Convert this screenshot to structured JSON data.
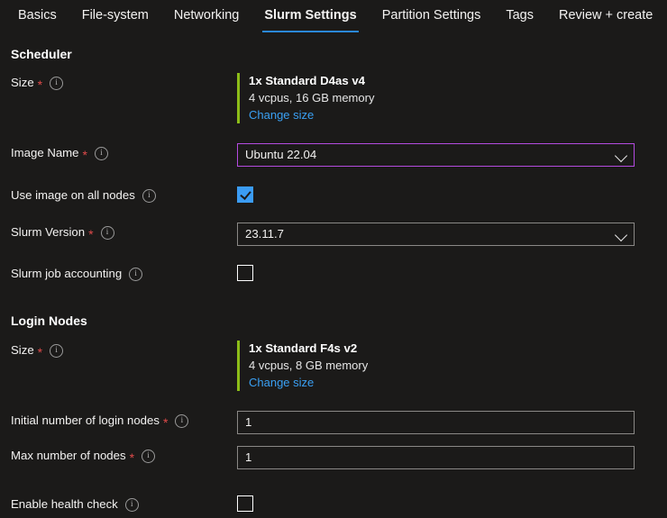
{
  "tabs": [
    {
      "label": "Basics",
      "active": false
    },
    {
      "label": "File-system",
      "active": false
    },
    {
      "label": "Networking",
      "active": false
    },
    {
      "label": "Slurm Settings",
      "active": true
    },
    {
      "label": "Partition Settings",
      "active": false
    },
    {
      "label": "Tags",
      "active": false
    },
    {
      "label": "Review + create",
      "active": false
    }
  ],
  "colors": {
    "page_background": "#1b1a19",
    "accent_tab_underline": "#2b88d8",
    "size_accent_bar": "#8cbd18",
    "link": "#3aa0f3",
    "focus_border": "#b44be0",
    "checkbox_checked": "#3b9cf4",
    "required_asterisk": "#e04a4a"
  },
  "scheduler": {
    "section_title": "Scheduler",
    "size": {
      "label": "Size",
      "required": "*",
      "info_icon": "info-icon",
      "name": "1x Standard D4as v4",
      "specs": "4 vcpus, 16 GB memory",
      "change_link": "Change size"
    },
    "image_name": {
      "label": "Image Name",
      "required": "*",
      "info_icon": "info-icon",
      "value": "Ubuntu 22.04",
      "chevron_icon": "chevron-down-icon",
      "focused": true
    },
    "use_image_all_nodes": {
      "label": "Use image on all nodes",
      "info_icon": "info-icon",
      "checked": true
    },
    "slurm_version": {
      "label": "Slurm Version",
      "required": "*",
      "info_icon": "info-icon",
      "value": "23.11.7",
      "chevron_icon": "chevron-down-icon",
      "focused": false
    },
    "slurm_job_accounting": {
      "label": "Slurm job accounting",
      "info_icon": "info-icon",
      "checked": false
    }
  },
  "login_nodes": {
    "section_title": "Login Nodes",
    "size": {
      "label": "Size",
      "required": "*",
      "info_icon": "info-icon",
      "name": "1x Standard F4s v2",
      "specs": "4 vcpus, 8 GB memory",
      "change_link": "Change size"
    },
    "initial_number": {
      "label": "Initial number of login nodes",
      "required": "*",
      "info_icon": "info-icon",
      "value": "1"
    },
    "max_number": {
      "label": "Max number of nodes",
      "required": "*",
      "info_icon": "info-icon",
      "value": "1"
    },
    "health_check": {
      "label": "Enable health check",
      "info_icon": "info-icon",
      "checked": false
    }
  }
}
